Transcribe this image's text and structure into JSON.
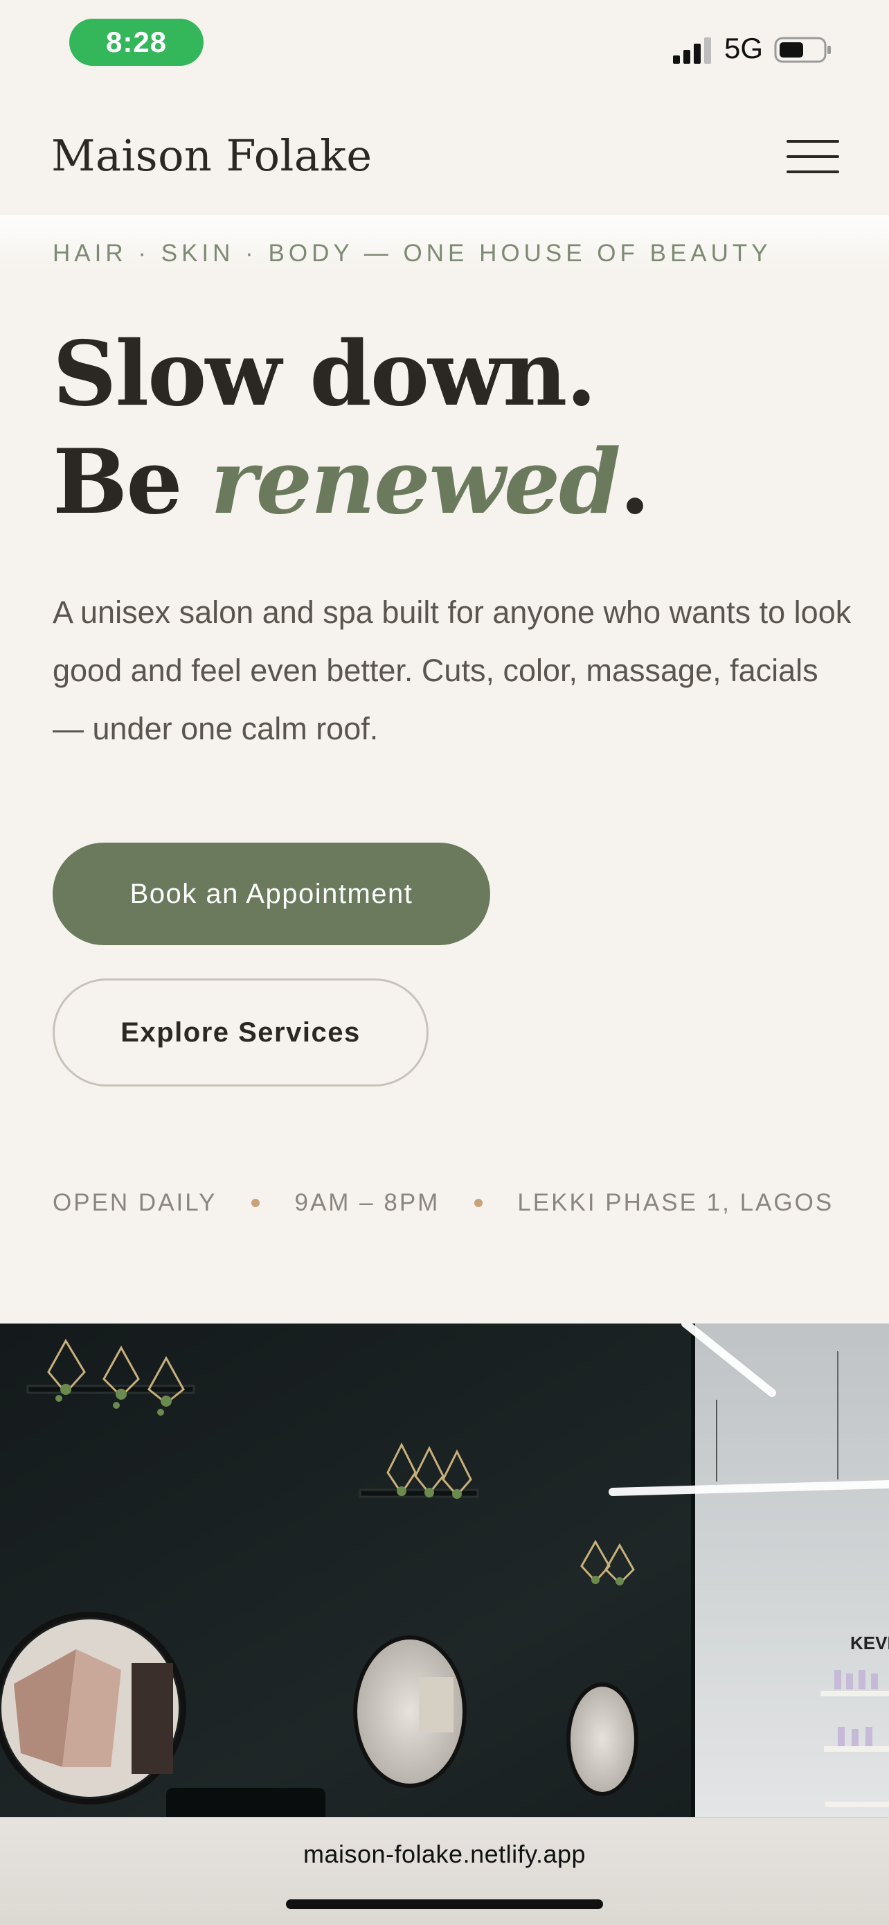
{
  "status_bar": {
    "time": "8:28",
    "network": "5G",
    "icons": [
      "signal-icon",
      "battery-icon"
    ]
  },
  "header": {
    "brand": "Maison Folake",
    "menu_icon": "hamburger-menu-icon"
  },
  "hero": {
    "eyebrow": "HAIR · SKIN · BODY — ONE HOUSE OF BEAUTY",
    "headline_line1": "Slow down.",
    "headline_line2_prefix": "Be ",
    "headline_line2_accent": "renewed",
    "headline_line2_suffix": ".",
    "intro": "A unisex salon and spa built for anyone who wants to look good and feel even better. Cuts, color, massage, facials — under one calm roof.",
    "primary_cta": "Book an Appointment",
    "secondary_cta": "Explore Services"
  },
  "info": {
    "hours_label": "OPEN DAILY",
    "hours": "9AM – 8PM",
    "location": "LEKKI PHASE 1, LAGOS"
  },
  "image": {
    "sign_text": "KEVI"
  },
  "browser": {
    "url": "maison-folake.netlify.app"
  },
  "colors": {
    "background": "#f6f3ee",
    "accent_green": "#6b7a5d",
    "status_green": "#34b65a",
    "dot": "#c9a27a"
  }
}
